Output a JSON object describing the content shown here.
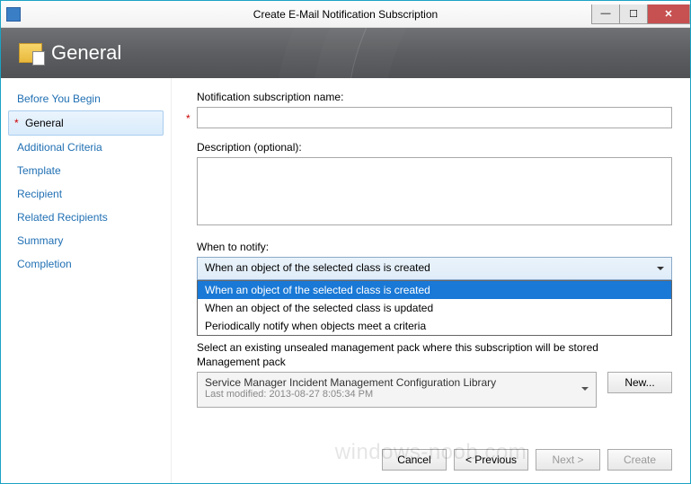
{
  "window": {
    "title": "Create E-Mail Notification Subscription"
  },
  "header": {
    "title": "General"
  },
  "sidebar": {
    "items": [
      "Before You Begin",
      "General",
      "Additional Criteria",
      "Template",
      "Recipient",
      "Related Recipients",
      "Summary",
      "Completion"
    ]
  },
  "form": {
    "name_label": "Notification subscription name:",
    "name_value": "",
    "desc_label": "Description (optional):",
    "desc_value": "",
    "when_label": "When to notify:",
    "when_selected": "When an object of the selected class is created",
    "when_options": [
      "When an object of the selected class is created",
      "When an object of the selected class is updated",
      "Periodically notify when objects meet a criteria"
    ],
    "mp_note": "Select an existing unsealed management pack where this subscription will be stored",
    "mp_label": "Management pack",
    "mp_value": "Service Manager Incident Management Configuration Library",
    "mp_sub": "Last modified:  2013-08-27 8:05:34 PM",
    "new_btn": "New..."
  },
  "footer": {
    "cancel": "Cancel",
    "previous": "<  Previous",
    "next": "Next  >",
    "create": "Create"
  },
  "watermark": "windows-noob.com"
}
